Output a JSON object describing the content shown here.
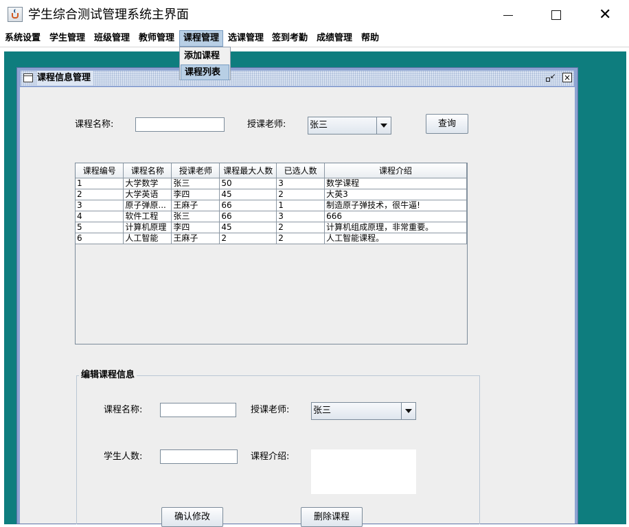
{
  "window": {
    "title": "学生综合测试管理系统主界面",
    "minimize_glyph": "",
    "close_glyph": "✕"
  },
  "menubar": {
    "items": [
      {
        "label": "系统设置"
      },
      {
        "label": "学生管理"
      },
      {
        "label": "班级管理"
      },
      {
        "label": "教师管理"
      },
      {
        "label": "课程管理",
        "active": true
      },
      {
        "label": "选课管理"
      },
      {
        "label": "签到考勤"
      },
      {
        "label": "成绩管理"
      },
      {
        "label": "帮助"
      }
    ]
  },
  "dropdown": {
    "items": [
      {
        "label": "添加课程"
      },
      {
        "label": "课程列表",
        "highlighted": true
      }
    ]
  },
  "colors": {
    "desktop": "#0e7d7e",
    "frame_border": "#8ea4d2",
    "menu_highlight": "#b8cfe5"
  },
  "frame": {
    "title": "课程信息管理",
    "restore_glyph": "↙",
    "close_glyph": "×"
  },
  "search": {
    "course_name_label": "课程名称:",
    "course_name_value": "",
    "teacher_label": "授课老师:",
    "teacher_value": "张三",
    "query_button": "查询"
  },
  "table": {
    "columns": [
      "课程编号",
      "课程名称",
      "授课老师",
      "课程最大人数",
      "已选人数",
      "课程介绍"
    ],
    "rows": [
      [
        "1",
        "大学数学",
        "张三",
        "50",
        "3",
        "数学课程"
      ],
      [
        "2",
        "大学英语",
        "李四",
        "45",
        "2",
        "大英3"
      ],
      [
        "3",
        "原子弹原...",
        "王麻子",
        "66",
        "1",
        "制造原子弹技术，很牛逼!"
      ],
      [
        "4",
        "软件工程",
        "张三",
        "66",
        "3",
        "666"
      ],
      [
        "5",
        "计算机原理",
        "李四",
        "45",
        "2",
        "计算机组成原理，非常重要。"
      ],
      [
        "6",
        "人工智能",
        "王麻子",
        "2",
        "2",
        "人工智能课程。"
      ]
    ]
  },
  "edit": {
    "group_title": "编辑课程信息",
    "course_name_label": "课程名称:",
    "course_name_value": "",
    "teacher_label": "授课老师:",
    "teacher_value": "张三",
    "student_count_label": "学生人数:",
    "student_count_value": "",
    "intro_label": "课程介绍:",
    "intro_value": "",
    "confirm_button": "确认修改",
    "delete_button": "删除课程"
  }
}
